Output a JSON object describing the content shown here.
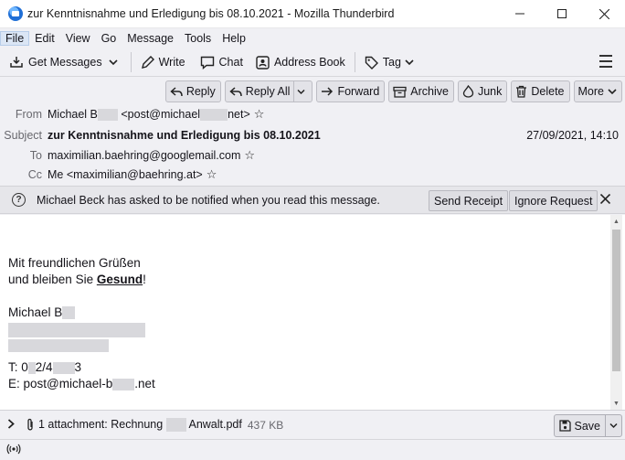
{
  "window": {
    "title": "zur Kenntnisnahme und Erledigung bis 08.10.2021 - Mozilla Thunderbird",
    "controls": {
      "minimize": "—",
      "maximize": "☐",
      "close": "✕"
    }
  },
  "menu": [
    "File",
    "Edit",
    "View",
    "Go",
    "Message",
    "Tools",
    "Help"
  ],
  "toolbar": {
    "get_messages": "Get Messages",
    "write": "Write",
    "chat": "Chat",
    "address_book": "Address Book",
    "tag": "Tag"
  },
  "actions": {
    "reply": "Reply",
    "reply_all": "Reply All",
    "forward": "Forward",
    "archive": "Archive",
    "junk": "Junk",
    "delete": "Delete",
    "more": "More"
  },
  "header": {
    "from_label": "From",
    "from_name": "Michael B",
    "from_email_prefix": "<post@michael",
    "from_email_suffix": "net>",
    "subject_label": "Subject",
    "subject": "zur Kenntnisnahme und Erledigung bis 08.10.2021",
    "date": "27/09/2021, 14:10",
    "to_label": "To",
    "to": "maximilian.baehring@googlemail.com",
    "cc_label": "Cc",
    "cc": "Me <maximilian@baehring.at>"
  },
  "notification": {
    "text": "Michael Beck has asked to be notified when you read this message.",
    "send_receipt": "Send Receipt",
    "ignore_request": "Ignore Request"
  },
  "body": {
    "line1": "Mit freundlichen Grüßen",
    "line2_prefix": "und bleiben Sie ",
    "line2_bold": "Gesund",
    "line2_suffix": "!",
    "signature_name": "Michael B",
    "phone_prefix": "T: 0",
    "phone_mid": "2/4",
    "phone_end": "3",
    "email_prefix": "E: post@michael-b",
    "email_suffix": ".net"
  },
  "attachment": {
    "summary_prefix": "1 attachment: Rechnung",
    "summary_suffix": "Anwalt.pdf",
    "size": "437 KB",
    "save": "Save"
  }
}
